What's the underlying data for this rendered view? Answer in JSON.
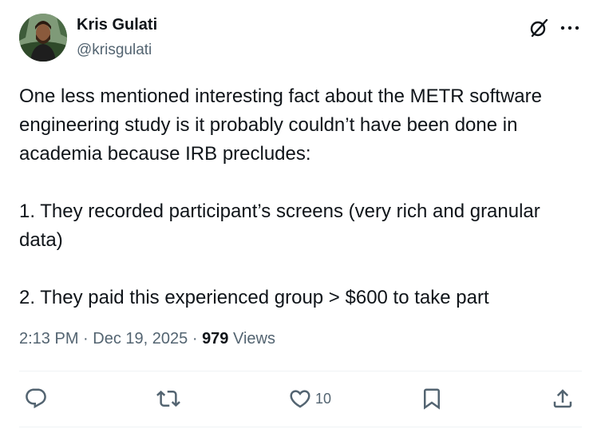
{
  "author": {
    "name": "Kris Gulati",
    "handle": "@krisgulati",
    "avatar": "avatar-photo"
  },
  "header_icons": [
    "grok-icon",
    "more-icon"
  ],
  "tweet": {
    "paragraphs": [
      "One less mentioned interesting fact about the METR software engineering study is it probably couldn’t have been done in academia because IRB precludes:",
      "1. They recorded participant’s screens (very rich and granular data)",
      "2. They paid this experienced group > $600 to take part"
    ]
  },
  "meta": {
    "time": "2:13 PM",
    "separator": "·",
    "date": "Dec 19, 2025",
    "views_count": "979",
    "views_label": "Views"
  },
  "actions": {
    "reply_icon": "reply-icon",
    "retweet_icon": "retweet-icon",
    "like_icon": "heart-icon",
    "like_count": "10",
    "bookmark_icon": "bookmark-icon",
    "share_icon": "share-icon"
  },
  "colors": {
    "text_primary": "#0f1419",
    "text_secondary": "#536471",
    "divider": "#eff3f4"
  }
}
